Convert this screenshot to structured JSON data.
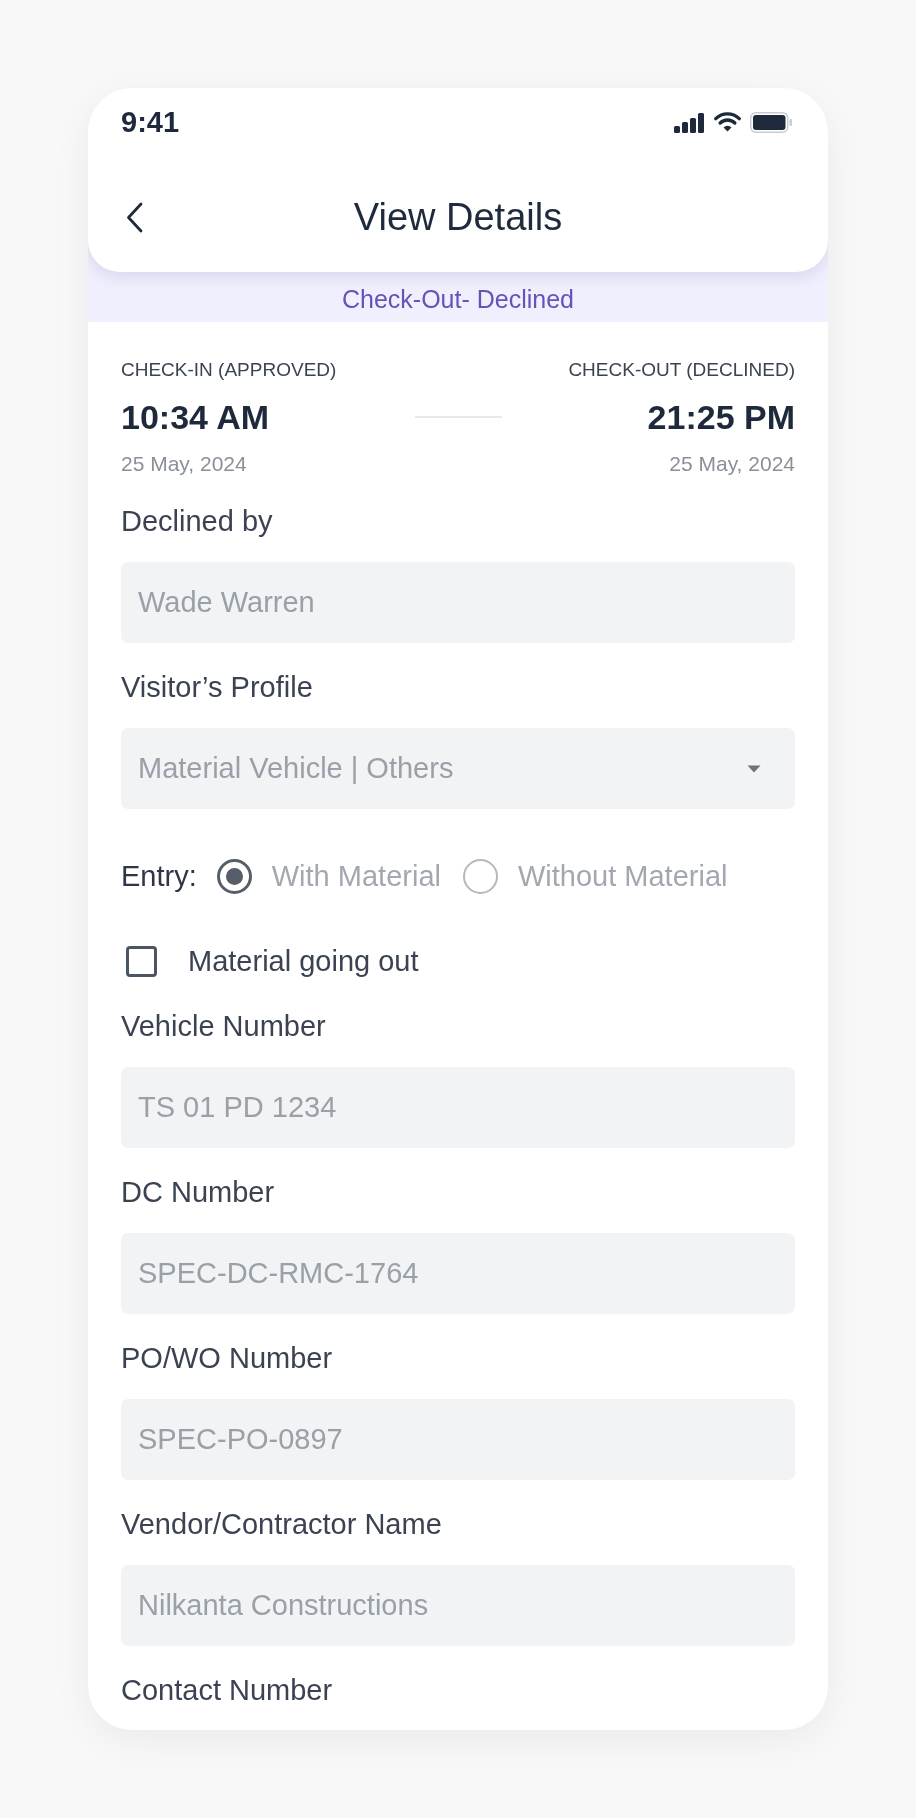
{
  "status_bar": {
    "time": "9:41"
  },
  "header": {
    "title": "View Details"
  },
  "status_banner": {
    "text": "Check-Out- Declined"
  },
  "timeline": [
    {
      "label": "CHECK-IN (APPROVED)",
      "time": "10:34 AM",
      "date": "25 May, 2024"
    },
    {
      "label": "CHECK-OUT (DECLINED)",
      "time": "21:25 PM",
      "date": "25 May, 2024"
    }
  ],
  "form": {
    "items": [
      {
        "kind": "field",
        "label": "Declined by",
        "value": "Wade Warren",
        "disabled": true
      },
      {
        "kind": "dropdown",
        "label": "Visitor’s Profile",
        "value": "Material Vehicle | Others",
        "disabled": true
      },
      {
        "kind": "radio_group",
        "label": "Entry:",
        "disabled": true,
        "options": [
          {
            "label": "With Material",
            "selected": true
          },
          {
            "label": "Without Material",
            "selected": false
          }
        ]
      },
      {
        "kind": "checkbox",
        "label": "Material going out",
        "checked": false,
        "disabled": false
      },
      {
        "kind": "field",
        "label": "Vehicle Number",
        "value": "TS 01 PD 1234",
        "disabled": true
      },
      {
        "kind": "field",
        "label": "DC Number",
        "value": "SPEC-DC-RMC-1764",
        "disabled": true
      },
      {
        "kind": "field",
        "label": "PO/WO Number",
        "value": "SPEC-PO-0897",
        "disabled": true
      },
      {
        "kind": "field",
        "label": "Vendor/Contractor Name",
        "value": "Nilkanta Constructions",
        "disabled": true
      },
      {
        "kind": "label",
        "label": "Contact Number"
      }
    ]
  }
}
